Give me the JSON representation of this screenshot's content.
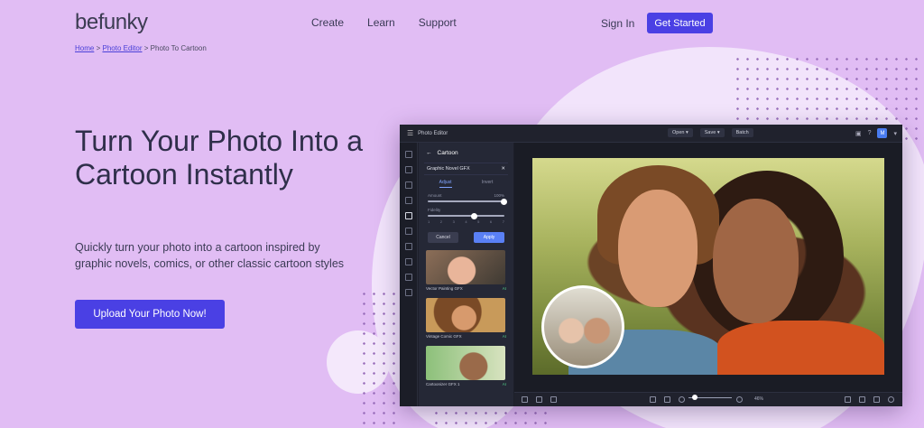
{
  "header": {
    "logo": "befunky",
    "nav": [
      "Create",
      "Learn",
      "Support"
    ],
    "sign_in": "Sign In",
    "get_started": "Get Started"
  },
  "breadcrumb": {
    "home": "Home",
    "sep1": ">",
    "photo_editor": "Photo Editor",
    "sep2": ">",
    "current": "Photo To Cartoon"
  },
  "hero": {
    "title": "Turn Your Photo Into a Cartoon Instantly",
    "subtitle": "Quickly turn your photo into a cartoon inspired by graphic novels, comics, or other classic cartoon styles",
    "cta": "Upload Your Photo Now!"
  },
  "app": {
    "title": "Photo Editor",
    "menu": [
      "Open",
      "Save",
      "Batch"
    ],
    "user_initial": "M",
    "panel": {
      "back_title": "Cartoon",
      "effect_name": "Graphic Novel GFX",
      "tabs": [
        "Adjust",
        "Invert"
      ],
      "amount_label": "Amount",
      "amount_value": "100%",
      "fidelity_label": "Fidelity",
      "fidelity_ticks": [
        "1",
        "2",
        "3",
        "4",
        "5",
        "6",
        "7"
      ],
      "cancel": "Cancel",
      "apply": "Apply",
      "presets": [
        {
          "name": "Vector Painting GFX",
          "badge": "AI"
        },
        {
          "name": "Vintage Comic GFX",
          "badge": "AI"
        },
        {
          "name": "Cartoonizer GFX 1",
          "badge": "AI"
        }
      ]
    },
    "zoom_value": "46%"
  },
  "colors": {
    "background": "#e1bdf4",
    "accent": "#4a40e4",
    "app_dark": "#1d1f2a"
  }
}
